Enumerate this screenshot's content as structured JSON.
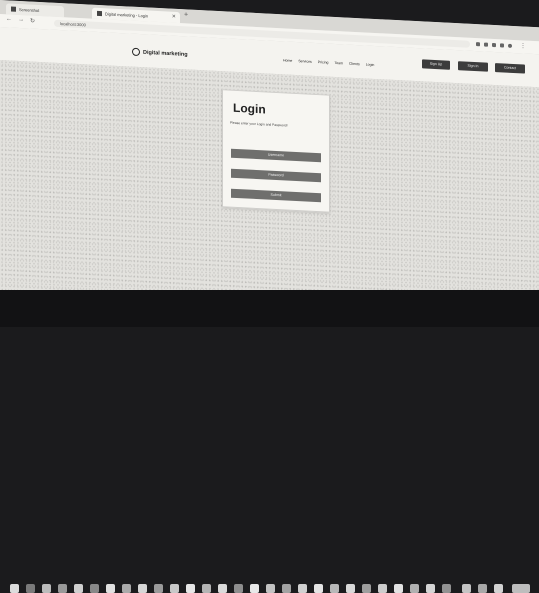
{
  "browser": {
    "tabs": [
      {
        "label": "Screenshot"
      },
      {
        "label": "Digital marketing - Login"
      }
    ],
    "new_tab_label": "+",
    "url": "localhost:3000"
  },
  "site": {
    "brand": "Digital marketing",
    "nav_links": [
      "Home",
      "Services",
      "Pricing",
      "Team",
      "Clients",
      "Login"
    ],
    "nav_buttons": [
      "Sign Up",
      "Sign In",
      "Contact"
    ]
  },
  "login": {
    "title": "Login",
    "subtitle": "Please enter your Login and Password!",
    "buttons": [
      "Username",
      "Password",
      "Submit"
    ]
  },
  "colors": {
    "page_bg": "#e3e2de",
    "card_bg": "#f7f6f2",
    "button_bg": "#6f6f6d",
    "nav_button_bg": "#3c3c3c",
    "taskbar_bg": "#121214"
  }
}
